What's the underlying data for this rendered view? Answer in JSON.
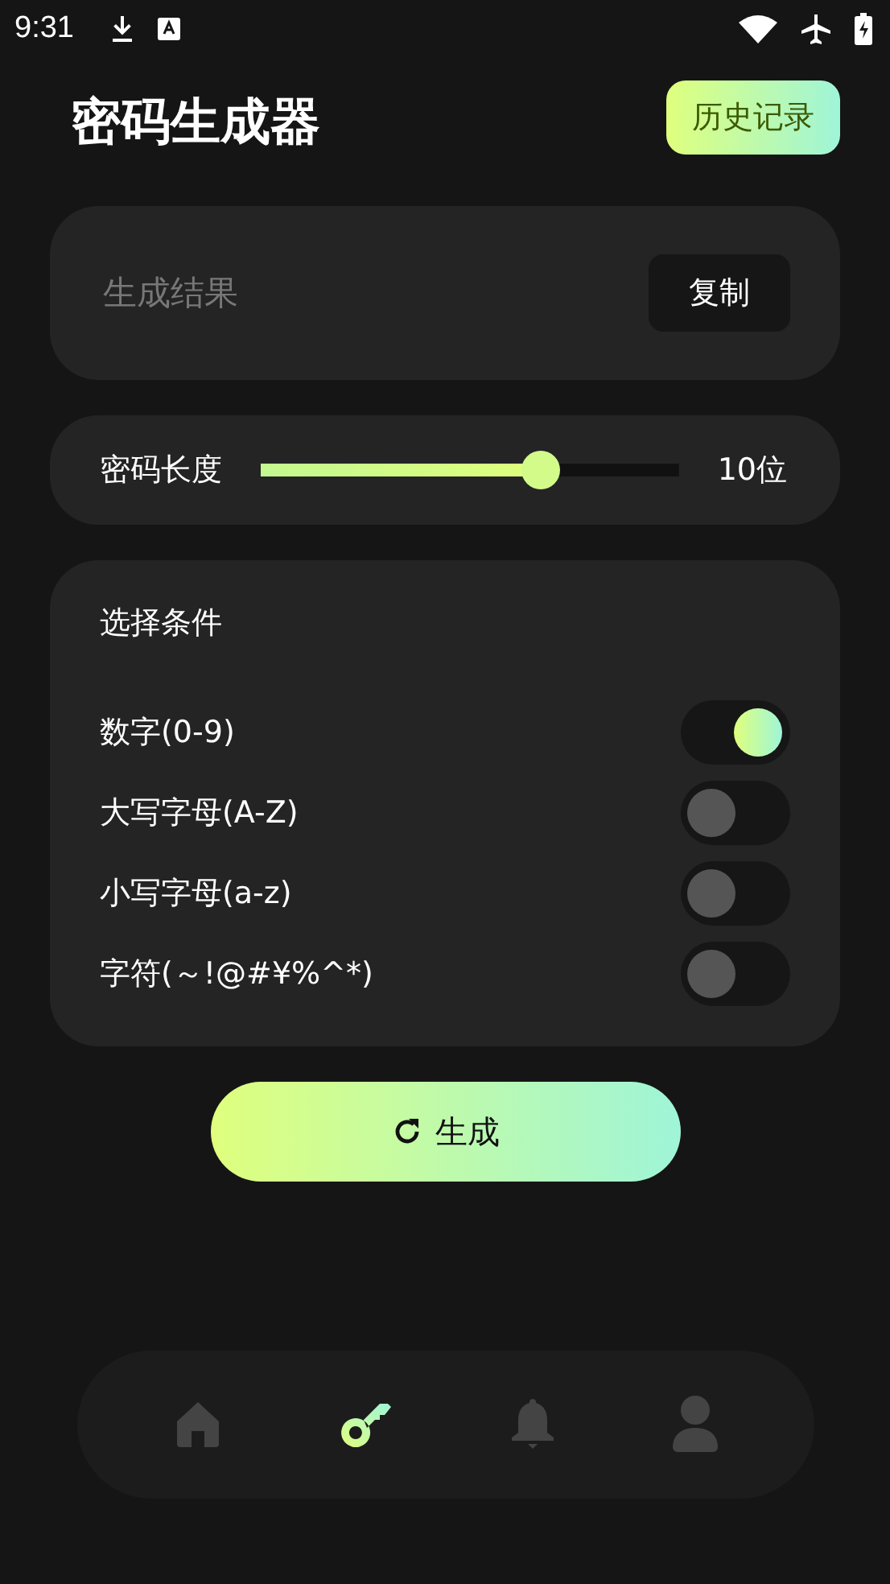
{
  "status_bar": {
    "time": "9:31"
  },
  "header": {
    "title": "密码生成器",
    "history_button": "历史记录"
  },
  "result": {
    "placeholder": "生成结果",
    "copy_button": "复制"
  },
  "length": {
    "label": "密码长度",
    "level": 0.67,
    "reading": "10位"
  },
  "conditions": {
    "title": "选择条件",
    "options": [
      {
        "label": "数字(0-9)",
        "on": true
      },
      {
        "label": "大写字母(A-Z)",
        "on": false
      },
      {
        "label": "小写字母(a-z)",
        "on": false
      },
      {
        "label": "字符(～!@#¥%^*)",
        "on": false
      }
    ]
  },
  "generate_button": "生成",
  "nav": [
    {
      "kind": "home",
      "selected": false
    },
    {
      "kind": "key",
      "selected": true
    },
    {
      "kind": "bell",
      "selected": false
    },
    {
      "kind": "person",
      "selected": false
    }
  ]
}
